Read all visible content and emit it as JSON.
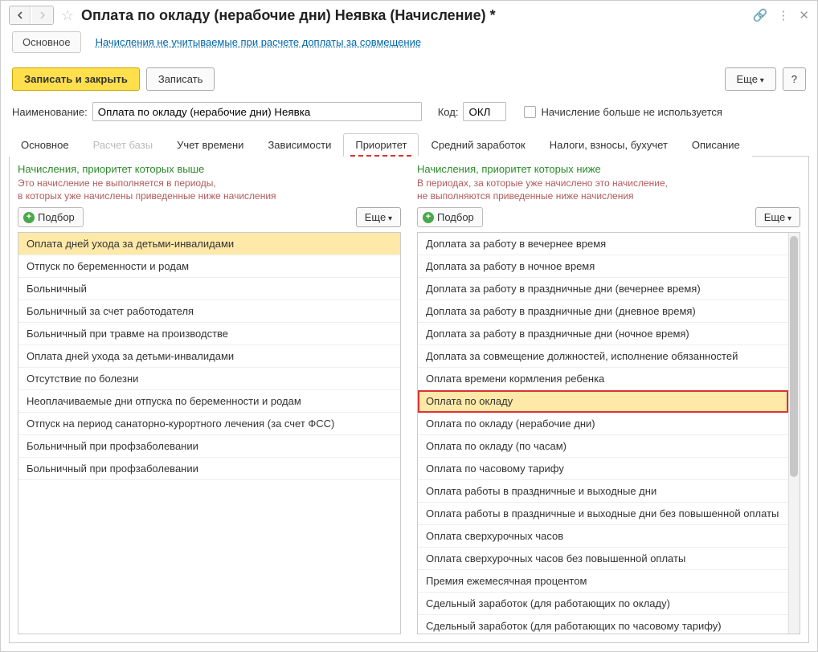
{
  "title": "Оплата по окладу (нерабочие дни) Неявка (Начисление) *",
  "sections": {
    "main": "Основное",
    "link": "Начисления не учитываемые при расчете доплаты за совмещение"
  },
  "toolbar": {
    "save_close": "Записать и закрыть",
    "save": "Записать",
    "more": "Еще",
    "help": "?"
  },
  "form": {
    "name_label": "Наименование:",
    "name_value": "Оплата по окладу (нерабочие дни) Неявка",
    "code_label": "Код:",
    "code_value": "ОКЛ",
    "cb_label": "Начисление больше не используется"
  },
  "tabs": [
    "Основное",
    "Расчет базы",
    "Учет времени",
    "Зависимости",
    "Приоритет",
    "Средний заработок",
    "Налоги, взносы, бухучет",
    "Описание"
  ],
  "active_tab": 4,
  "disabled_tab": 1,
  "left_pane": {
    "title": "Начисления, приоритет которых выше",
    "sub1": "Это начисление не выполняется в периоды,",
    "sub2": "в которых уже начислены приведенные ниже начисления",
    "select": "Подбор",
    "more": "Еще",
    "items": [
      "Оплата дней ухода за детьми-инвалидами",
      "Отпуск по беременности и родам",
      "Больничный",
      "Больничный за счет работодателя",
      "Больничный при травме на производстве",
      "Оплата дней ухода за детьми-инвалидами",
      "Отсутствие по болезни",
      "Неоплачиваемые дни отпуска по беременности и родам",
      "Отпуск на период санаторно-курортного лечения (за счет ФСС)",
      "Больничный при профзаболевании",
      "Больничный при профзаболевании"
    ],
    "selected_index": 0
  },
  "right_pane": {
    "title": "Начисления, приоритет которых ниже",
    "sub1": "В периодах, за которые уже начислено это начисление,",
    "sub2": "не выполняются приведенные ниже начисления",
    "select": "Подбор",
    "more": "Еще",
    "items": [
      "Доплата за работу в вечернее время",
      "Доплата за работу в ночное время",
      "Доплата за работу в праздничные дни (вечернее время)",
      "Доплата за работу в праздничные дни (дневное время)",
      "Доплата за работу в праздничные дни (ночное время)",
      "Доплата за совмещение должностей, исполнение обязанностей",
      "Оплата времени кормления ребенка",
      "Оплата по окладу",
      "Оплата по окладу (нерабочие дни)",
      "Оплата по окладу (по часам)",
      "Оплата по часовому тарифу",
      "Оплата работы в праздничные и выходные дни",
      "Оплата работы в праздничные и выходные дни без повышенной оплаты",
      "Оплата сверхурочных часов",
      "Оплата сверхурочных часов без повышенной оплаты",
      "Премия ежемесячная процентом",
      "Сдельный заработок (для работающих по окладу)",
      "Сдельный заработок (для работающих по часовому тарифу)"
    ],
    "highlight_index": 7
  }
}
